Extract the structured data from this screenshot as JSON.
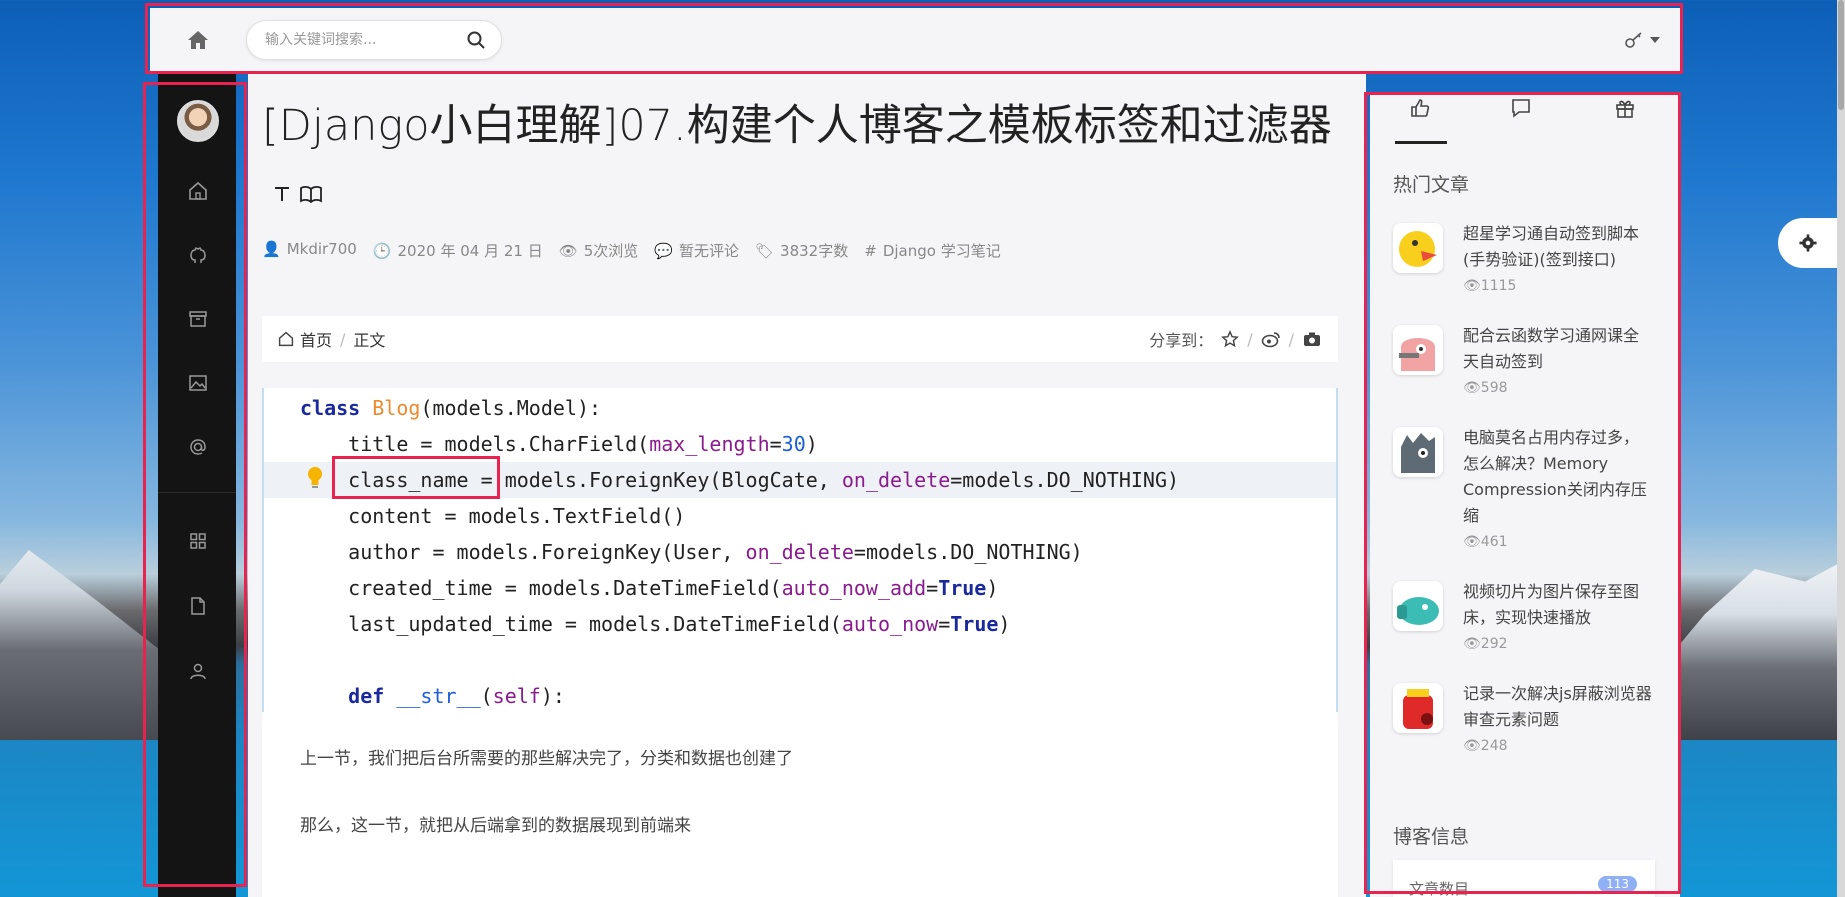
{
  "header": {
    "search_placeholder": "输入关键词搜索..."
  },
  "article": {
    "title": "[Django小白理解]07.构建个人博客之模板标签和过滤器",
    "meta": {
      "author": "Mkdir700",
      "date": "2020 年 04 月 21 日",
      "views": "5次浏览",
      "comments": "暂无评论",
      "words": "3832字数",
      "tags": "Django 学习笔记"
    },
    "breadcrumb": {
      "home": "首页",
      "current": "正文"
    },
    "share_label": "分享到：",
    "code_lines": {
      "l1_kw": "class",
      "l1_cls": "Blog",
      "l1_rest": "(models.Model):",
      "l2_a": "    title = models.CharField(",
      "l2_arg": "max_length",
      "l2_eq": "=",
      "l2_num": "30",
      "l2_end": ")",
      "l3_name": "class_name",
      "l3_a": " = models.ForeignKey(BlogCate, ",
      "l3_arg": "on_delete",
      "l3_b": "=models.DO_NOTHING)",
      "l4": "    content = models.TextField()",
      "l5_a": "    author = models.ForeignKey(User, ",
      "l5_arg": "on_delete",
      "l5_b": "=models.DO_NOTHING)",
      "l6_a": "    created_time = models.DateTimeField(",
      "l6_arg": "auto_now_add",
      "l6_eq": "=",
      "l6_kw": "True",
      "l6_end": ")",
      "l7_a": "    last_updated_time = models.DateTimeField(",
      "l7_arg": "auto_now",
      "l7_eq": "=",
      "l7_kw": "True",
      "l7_end": ")",
      "l8_indent": "    ",
      "l8_kw": "def",
      "l8_fn": " __str__",
      "l8_a": "(",
      "l8_arg": "self",
      "l8_end": "):"
    },
    "paragraphs": [
      "上一节，我们把后台所需要的那些解决完了，分类和数据也创建了",
      "那么，这一节，就把从后端拿到的数据展现到前端来"
    ]
  },
  "right_sidebar": {
    "hot_title": "热门文章",
    "hot_articles": [
      {
        "title": "超星学习通自动签到脚本(手势验证)(签到接口)",
        "views": "1115"
      },
      {
        "title": "配合云函数学习通网课全天自动签到",
        "views": "598"
      },
      {
        "title": "电脑莫名占用内存过多，怎么解决？Memory Compression关闭内存压缩",
        "views": "461"
      },
      {
        "title": "视频切片为图片保存至图床，实现快速播放",
        "views": "292"
      },
      {
        "title": "记录一次解决js屏蔽浏览器审查元素问题",
        "views": "248"
      }
    ],
    "blog_info_title": "博客信息",
    "info_article_count_label": "文章数目",
    "info_article_count": "113"
  },
  "colors": {
    "highlight_box": "#e8234f",
    "sidebar_bg": "#141414",
    "panel_bg": "#f5f5f7"
  }
}
